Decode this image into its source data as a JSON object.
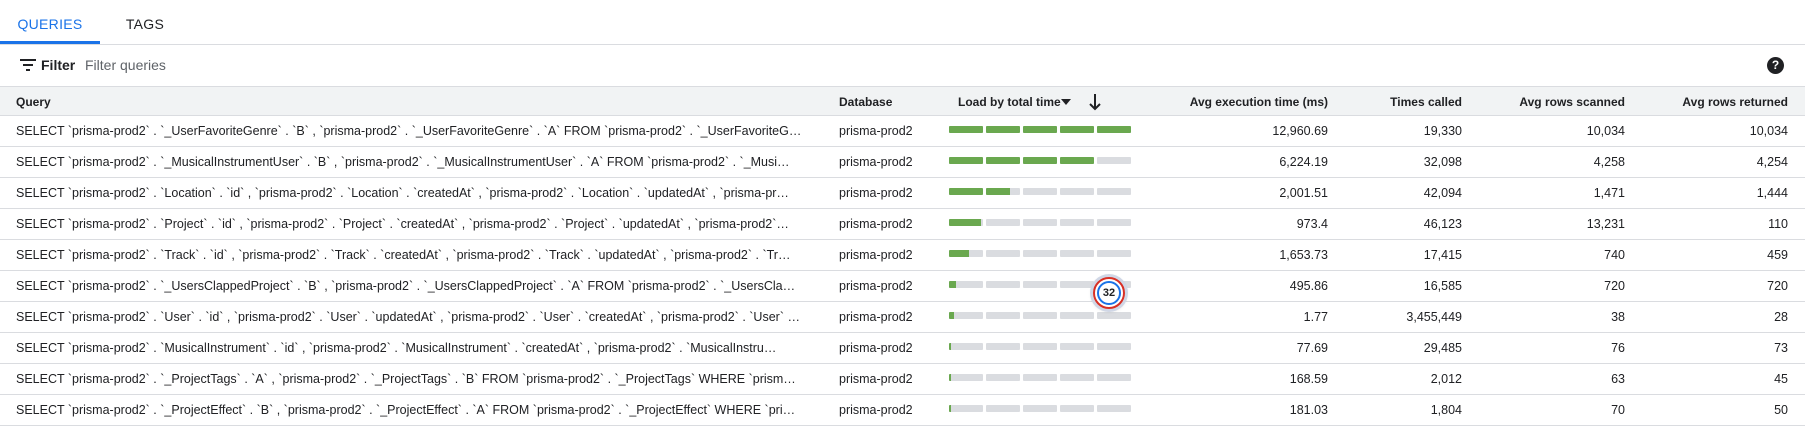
{
  "tabs": [
    {
      "label": "QUERIES",
      "active": true
    },
    {
      "label": "TAGS",
      "active": false
    }
  ],
  "filter": {
    "label": "Filter",
    "placeholder": "Filter queries",
    "icon": "filter-icon",
    "help_icon": "help-icon",
    "help_glyph": "?"
  },
  "columns": {
    "query": "Query",
    "database": "Database",
    "load": "Load by total time",
    "avg_exec": "Avg execution time (ms)",
    "times_called": "Times called",
    "avg_scanned": "Avg rows scanned",
    "avg_returned": "Avg rows returned"
  },
  "sort": {
    "column": "load",
    "direction": "descending"
  },
  "colors": {
    "accent": "#1a73e8",
    "bar_fill": "#6aa84f",
    "bar_track": "#dadce0",
    "header_bg": "#f1f3f4"
  },
  "rows": [
    {
      "query": "SELECT `prisma-prod2` . `_UserFavoriteGenre` . `B` , `prisma-prod2` . `_UserFavoriteGenre` . `A` FROM `prisma-prod2` . `_UserFavoriteG…",
      "database": "prisma-prod2",
      "load": 1.0,
      "avg_exec": "12,960.69",
      "times_called": "19,330",
      "avg_scanned": "10,034",
      "avg_returned": "10,034"
    },
    {
      "query": "SELECT `prisma-prod2` . `_MusicalInstrumentUser` . `B` , `prisma-prod2` . `_MusicalInstrumentUser` . `A` FROM `prisma-prod2` . `_Musi…",
      "database": "prisma-prod2",
      "load": 0.8,
      "avg_exec": "6,224.19",
      "times_called": "32,098",
      "avg_scanned": "4,258",
      "avg_returned": "4,254"
    },
    {
      "query": "SELECT `prisma-prod2` . `Location` . `id` , `prisma-prod2` . `Location` . `createdAt` , `prisma-prod2` . `Location` . `updatedAt` , `prisma-pr…",
      "database": "prisma-prod2",
      "load": 0.34,
      "avg_exec": "2,001.51",
      "times_called": "42,094",
      "avg_scanned": "1,471",
      "avg_returned": "1,444"
    },
    {
      "query": "SELECT `prisma-prod2` . `Project` . `id` , `prisma-prod2` . `Project` . `createdAt` , `prisma-prod2` . `Project` . `updatedAt` , `prisma-prod2`…",
      "database": "prisma-prod2",
      "load": 0.19,
      "avg_exec": "973.4",
      "times_called": "46,123",
      "avg_scanned": "13,231",
      "avg_returned": "110"
    },
    {
      "query": "SELECT `prisma-prod2` . `Track` . `id` , `prisma-prod2` . `Track` . `createdAt` , `prisma-prod2` . `Track` . `updatedAt` , `prisma-prod2` . `Tr…",
      "database": "prisma-prod2",
      "load": 0.12,
      "avg_exec": "1,653.73",
      "times_called": "17,415",
      "avg_scanned": "740",
      "avg_returned": "459"
    },
    {
      "query": "SELECT `prisma-prod2` . `_UsersClappedProject` . `B` , `prisma-prod2` . `_UsersClappedProject` . `A` FROM `prisma-prod2` . `_UsersCla…",
      "database": "prisma-prod2",
      "load": 0.04,
      "avg_exec": "495.86",
      "times_called": "16,585",
      "avg_scanned": "720",
      "avg_returned": "720"
    },
    {
      "query": "SELECT `prisma-prod2` . `User` . `id` , `prisma-prod2` . `User` . `updatedAt` , `prisma-prod2` . `User` . `createdAt` , `prisma-prod2` . `User` …",
      "database": "prisma-prod2",
      "load": 0.03,
      "avg_exec": "1.77",
      "times_called": "3,455,449",
      "avg_scanned": "38",
      "avg_returned": "28"
    },
    {
      "query": "SELECT `prisma-prod2` . `MusicalInstrument` . `id` , `prisma-prod2` . `MusicalInstrument` . `createdAt` , `prisma-prod2` . `MusicalInstru…",
      "database": "prisma-prod2",
      "load": 0.012,
      "avg_exec": "77.69",
      "times_called": "29,485",
      "avg_scanned": "76",
      "avg_returned": "73"
    },
    {
      "query": "SELECT `prisma-prod2` . `_ProjectTags` . `A` , `prisma-prod2` . `_ProjectTags` . `B` FROM `prisma-prod2` . `_ProjectTags` WHERE `prism…",
      "database": "prisma-prod2",
      "load": 0.01,
      "avg_exec": "168.59",
      "times_called": "2,012",
      "avg_scanned": "63",
      "avg_returned": "45"
    },
    {
      "query": "SELECT `prisma-prod2` . `_ProjectEffect` . `B` , `prisma-prod2` . `_ProjectEffect` . `A` FROM `prisma-prod2` . `_ProjectEffect` WHERE `pri…",
      "database": "prisma-prod2",
      "load": 0.01,
      "avg_exec": "181.03",
      "times_called": "1,804",
      "avg_scanned": "70",
      "avg_returned": "50"
    }
  ],
  "overlay_badge": {
    "text": "32"
  }
}
